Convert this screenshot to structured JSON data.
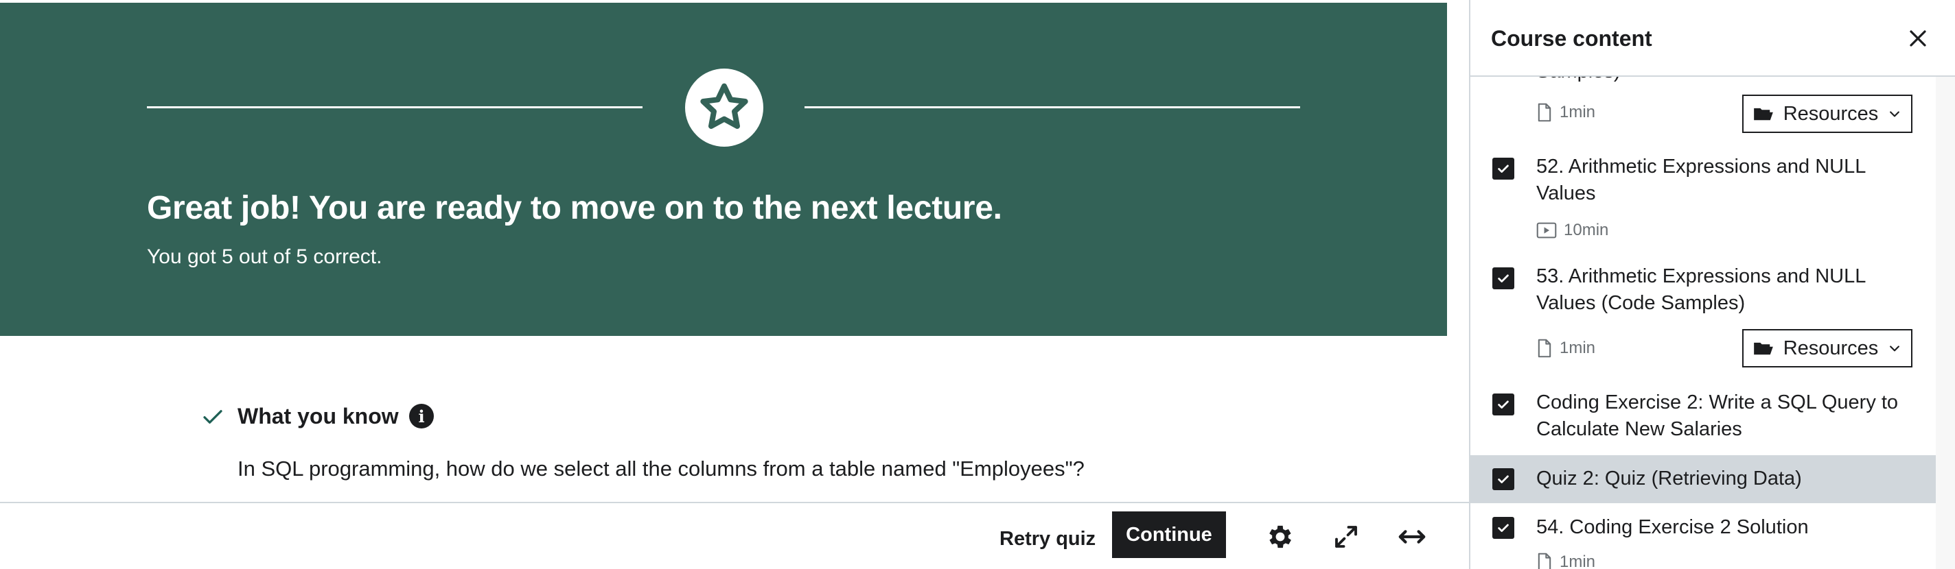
{
  "quiz_result": {
    "title": "Great job! You are ready to move on to the next lecture.",
    "score_text": "You got 5 out of 5 correct.",
    "badge_icon": "star-icon"
  },
  "what_you_know": {
    "heading": "What you know",
    "question": "In SQL programming, how do we select all the columns from a table named \"Employees\"?"
  },
  "footer": {
    "retry_label": "Retry quiz",
    "continue_label": "Continue",
    "icons": [
      "gear-icon",
      "fullscreen-icon",
      "expand-icon"
    ]
  },
  "sidebar": {
    "title": "Course content",
    "items": [
      {
        "title_fragment": "Samples)",
        "duration": "1min",
        "type": "file",
        "resources_label": "Resources"
      },
      {
        "title": "52. Arithmetic Expressions and NULL Values",
        "duration": "10min",
        "type": "video",
        "checked": true
      },
      {
        "title": "53. Arithmetic Expressions and NULL Values (Code Samples)",
        "duration": "1min",
        "type": "file",
        "resources_label": "Resources",
        "checked": true
      },
      {
        "title": "Coding Exercise 2: Write a SQL Query to Calculate New Salaries",
        "checked": true
      },
      {
        "title": "Quiz 2: Quiz (Retrieving Data)",
        "checked": true,
        "active": true
      },
      {
        "title": "54. Coding Exercise 2 Solution",
        "duration": "1min",
        "type": "file",
        "checked": true
      }
    ]
  },
  "colors": {
    "banner": "#336257",
    "ink": "#1c1d1f",
    "success": "#1e6055",
    "active_row": "#d1d7dc"
  }
}
